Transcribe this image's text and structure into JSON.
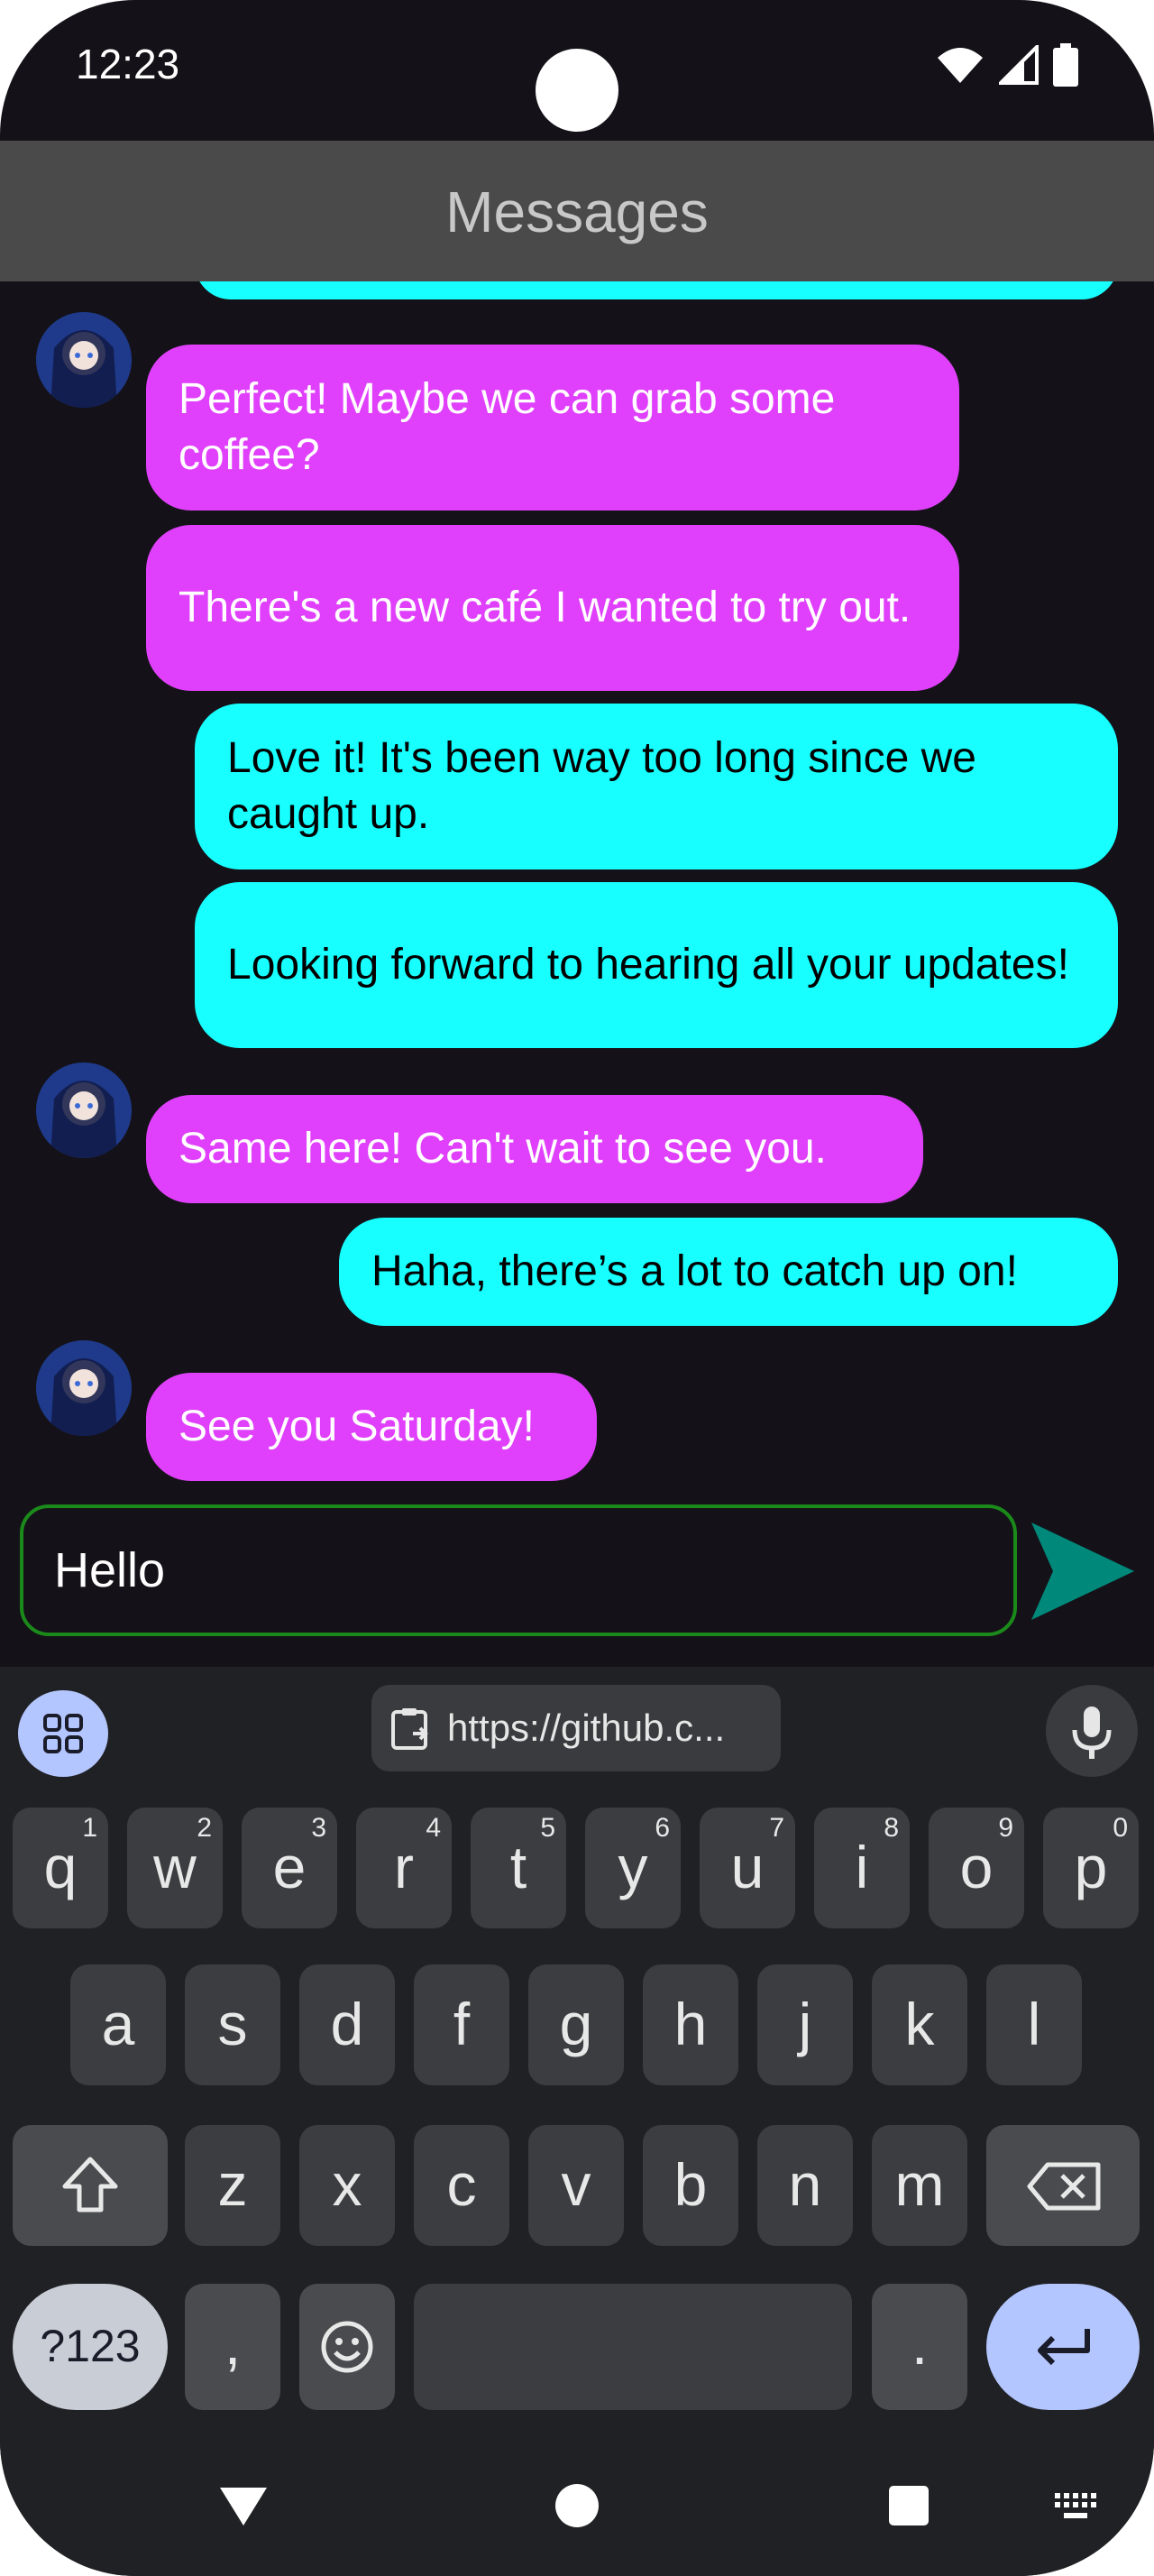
{
  "status": {
    "time": "12:23"
  },
  "appbar": {
    "title": "Messages"
  },
  "messages": [
    {
      "side": "in",
      "text": "Perfect! Maybe we can grab some coffee?"
    },
    {
      "side": "in",
      "text": "There's a new café I wanted to try out."
    },
    {
      "side": "out",
      "text": "Love it! It's been way too long since we caught up."
    },
    {
      "side": "out",
      "text": "Looking forward to hearing all your updates!"
    },
    {
      "side": "in",
      "text": "Same here! Can't wait to see you."
    },
    {
      "side": "out",
      "text": "Haha, there’s a lot to catch up on!"
    },
    {
      "side": "in",
      "text": "See you Saturday!"
    }
  ],
  "composer": {
    "value": "Hello"
  },
  "keyboard": {
    "clipboard": "https://github.c...",
    "row1": [
      {
        "k": "q",
        "h": "1"
      },
      {
        "k": "w",
        "h": "2"
      },
      {
        "k": "e",
        "h": "3"
      },
      {
        "k": "r",
        "h": "4"
      },
      {
        "k": "t",
        "h": "5"
      },
      {
        "k": "y",
        "h": "6"
      },
      {
        "k": "u",
        "h": "7"
      },
      {
        "k": "i",
        "h": "8"
      },
      {
        "k": "o",
        "h": "9"
      },
      {
        "k": "p",
        "h": "0"
      }
    ],
    "row2": [
      "a",
      "s",
      "d",
      "f",
      "g",
      "h",
      "j",
      "k",
      "l"
    ],
    "row3": [
      "z",
      "x",
      "c",
      "v",
      "b",
      "n",
      "m"
    ],
    "symbols_label": "?123",
    "comma": ",",
    "period": "."
  },
  "colors": {
    "incoming": "#e040fb",
    "outgoing": "#18ffff",
    "send": "#00897b",
    "accent": "#b4c6ff"
  }
}
